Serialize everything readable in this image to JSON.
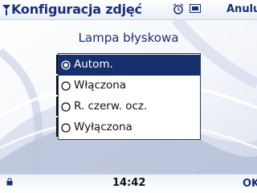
{
  "header": {
    "title": "Konfiguracja zdjęć",
    "cancel_label": "Anuluj",
    "icons": [
      "signal-icon",
      "alarm-icon",
      "battery-icon"
    ]
  },
  "dialog": {
    "title": "Lampa błyskowa",
    "options": [
      {
        "label": "Autom.",
        "icon": "flash-auto-icon",
        "selected": true
      },
      {
        "label": "Włączona",
        "icon": "flash-on-icon",
        "selected": false
      },
      {
        "label": "R. czerw. ocz.",
        "icon": "red-eye-icon",
        "selected": false
      },
      {
        "label": "Wyłączona",
        "icon": "flash-off-icon",
        "selected": false
      }
    ]
  },
  "footer": {
    "time": "14:42",
    "ok_label": "OK"
  },
  "colors": {
    "accent": "#1a2f7a",
    "selection": "#182f6e"
  }
}
